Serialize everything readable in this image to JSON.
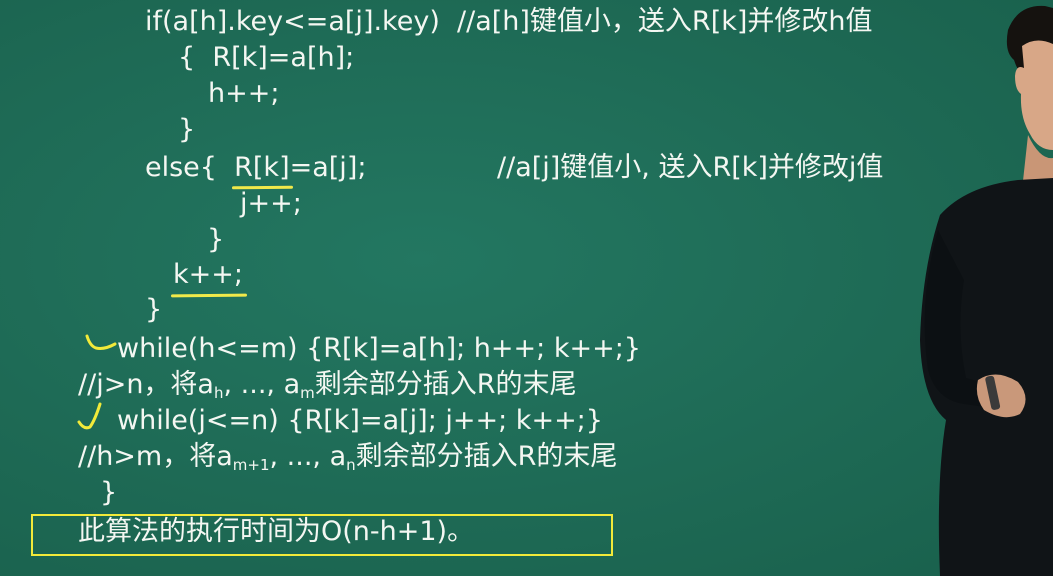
{
  "code": {
    "line1": "if(a[h].key<=a[j].key)  //a[h]键值小，送入R[k]并修改h值",
    "line2": "{  R[k]=a[h];",
    "line3": "h++;",
    "line4": "}",
    "line5_prefix": "else{  ",
    "line5_highlight": "R[k]",
    "line5_rest": "=a[j];",
    "line5_comment": "//a[j]键值小, 送入R[k]并修改j值",
    "line6": "j++;",
    "line7": "}",
    "line8": "k++;",
    "line9": "}",
    "line10": "while(h<=m) {R[k]=a[h]; h++; k++;}",
    "line11_a": "//j>n，将a",
    "line11_sub1": "h",
    "line11_b": ", ..., a",
    "line11_sub2": "m",
    "line11_c": "剩余部分插入R的末尾",
    "line12": "while(j<=n) {R[k]=a[j]; j++; k++;}",
    "line13_a": "//h>m，将a",
    "line13_sub1": "m+1",
    "line13_b": ", ..., a",
    "line13_sub2": "n",
    "line13_c": "剩余部分插入R的末尾",
    "line14": "}"
  },
  "summary": {
    "text": "此算法的执行时间为O(n-h+1)。"
  },
  "colors": {
    "board": "#1f6b55",
    "chalk": "#f4f7f2",
    "highlight": "#f2ea3a"
  }
}
